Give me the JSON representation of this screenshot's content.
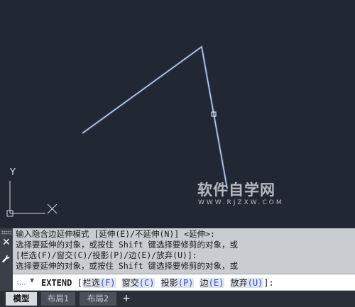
{
  "watermark": {
    "main": "软件自学网",
    "sub": "WWW.RJZXW.COM"
  },
  "ucs": {
    "y_label": "Y",
    "x_label": "X"
  },
  "command_history": [
    "输入隐含边延伸模式 [延伸(E)/不延伸(N)] <延伸>:",
    "选择要延伸的对象，或按住 Shift 键选择要修剪的对象，或",
    "[栏选(F)/窗交(C)/投影(P)/边(E)/放弃(U)]:",
    "选择要延伸的对象，或按住 Shift 键选择要修剪的对象，或"
  ],
  "command_line": {
    "command": "EXTEND",
    "open": "[",
    "options": [
      {
        "label": "栏选",
        "key": "(F)"
      },
      {
        "label": "窗交",
        "key": "(C)"
      },
      {
        "label": "投影",
        "key": "(P)"
      },
      {
        "label": "边",
        "key": "(E)"
      },
      {
        "label": "放弃",
        "key": "(U)"
      }
    ],
    "close": "]:"
  },
  "sidebar": {
    "close_glyph": "✕"
  },
  "tabs": [
    {
      "label": "模型",
      "active": true
    },
    {
      "label": "布局1",
      "active": false
    },
    {
      "label": "布局2",
      "active": false
    }
  ],
  "tab_add_glyph": "+",
  "colors": {
    "canvas": "#222833",
    "line": "#cfe1ff",
    "command_bg": "#c9ccd0",
    "option_key": "#2b53c9"
  }
}
